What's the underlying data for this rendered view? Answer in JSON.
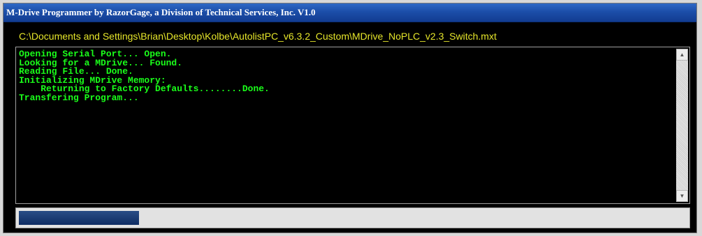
{
  "window": {
    "title": "M-Drive Programmer by RazorGage, a Division of Technical Services, Inc.  V1.0"
  },
  "file_path": "C:\\Documents and Settings\\Brian\\Desktop\\Kolbe\\AutolistPC_v6.3.2_Custom\\MDrive_NoPLC_v2.3_Switch.mxt",
  "console": {
    "lines": [
      "Opening Serial Port... Open.",
      "Looking for a MDrive... Found.",
      "Reading File... Done.",
      "Initializing MDrive Memory:",
      "    Returning to Factory Defaults........Done.",
      "Transfering Program..."
    ],
    "text_color": "#1aff1a",
    "background": "#000000"
  },
  "scrollbar": {
    "up_icon": "triangle-up",
    "down_icon": "triangle-down"
  },
  "progress": {
    "fraction": 0.18,
    "fill_color": "#1a3a73"
  }
}
